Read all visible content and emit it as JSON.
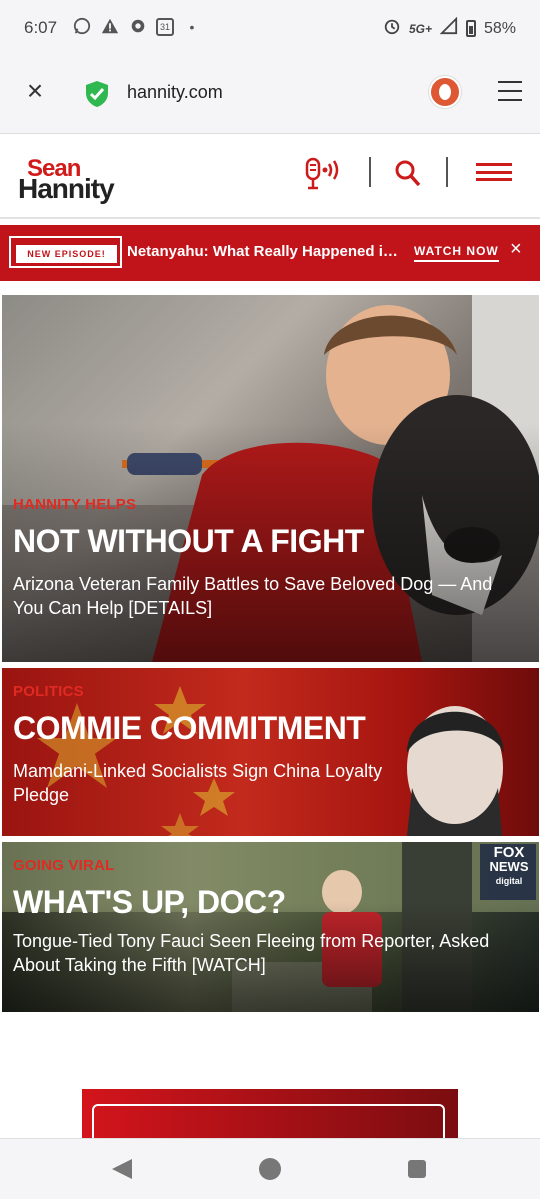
{
  "status_bar": {
    "time": "6:07",
    "left_icons": [
      "whatsapp-icon",
      "warning-icon",
      "settings-gear-icon",
      "calendar-icon",
      "dot-icon"
    ],
    "calendar_day": "31",
    "network": "5G+",
    "battery": "58%"
  },
  "browser": {
    "url": "hannity.com",
    "shield_color": "#2fb84f",
    "ddg_color": "#de5833"
  },
  "site": {
    "logo_top": "Sean",
    "logo_bottom": "Hannity",
    "accent_color": "#cc1b1b"
  },
  "banner": {
    "badge": "NEW EPISODE!",
    "headline": "Netanyahu: What Really Happened in Iran",
    "cta": "WATCH NOW",
    "close": "×"
  },
  "stories": [
    {
      "kicker": "HANNITY HELPS",
      "title": "NOT WITHOUT A FIGHT",
      "dek": "Arizona Veteran Family Battles to Save Beloved Dog — And You Can Help [DETAILS]"
    },
    {
      "kicker": "POLITICS",
      "title": "COMMIE COMMITMENT",
      "dek": "Mamdani-Linked Socialists Sign China Loyalty Pledge"
    },
    {
      "kicker": "GOING VIRAL",
      "title": "WHAT'S UP, DOC?",
      "dek": "Tongue-Tied Tony Fauci Seen Fleeing from Reporter, Asked About Taking the Fifth [WATCH]",
      "watermark": [
        "FOX",
        "NEWS",
        "digital"
      ]
    }
  ]
}
